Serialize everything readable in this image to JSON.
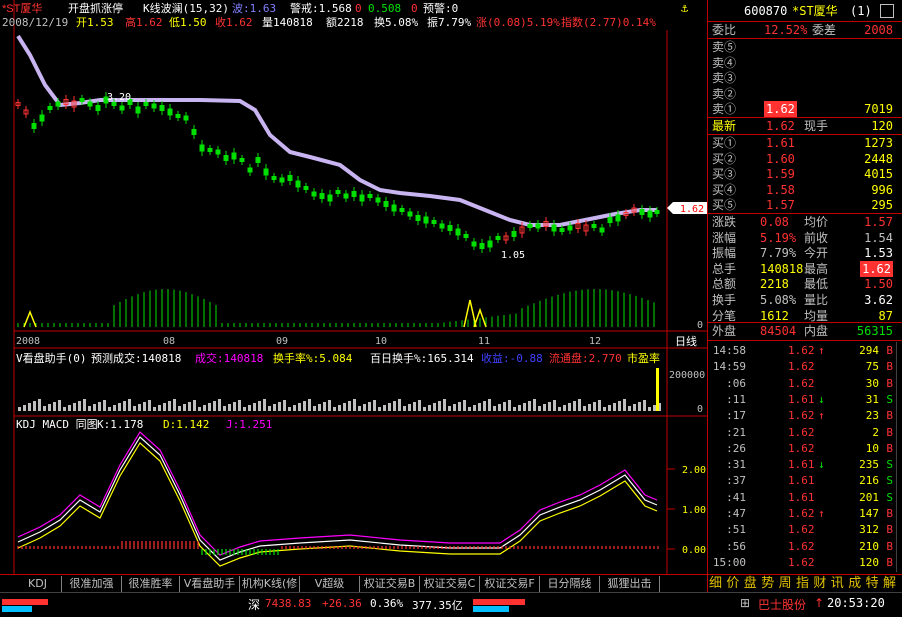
{
  "header": {
    "stock_name": "*ST厦华",
    "strategy": "开盘抓涨停",
    "indicator": "K线波澜(15,32)",
    "wave": "波:1.63",
    "warn_label": "警戒:1.568",
    "val_zero": "0",
    "val_508": "0.508",
    "val_zero2": "0",
    "alert": "预警:0"
  },
  "info_line": {
    "date": "2008/12/19",
    "open": "开1.53",
    "high": "高1.62",
    "low": "低1.50",
    "close": "收1.62",
    "volume": "量140818",
    "amount": "额2218",
    "turnover": "换5.08%",
    "amplitude": "振7.79%",
    "change": "涨(0.08)5.19%",
    "index": "指数(2.77)0.14%"
  },
  "chart_labels": {
    "peak_label": "3.20",
    "low_label": "1.05",
    "price_tag": "1.62",
    "vol_zero": "0",
    "months": [
      "2008",
      "08",
      "09",
      "10",
      "11",
      "12"
    ],
    "period": "日线"
  },
  "vol_panel": {
    "title": "V看盘助手(0)",
    "forecast": "预测成交:140818",
    "deal": "成交:140818",
    "turnover_rate": "换手率%:5.084",
    "hundred_day": "百日换手%:165.314",
    "profit": "收益:-0.88",
    "float": "流通盘:2.770",
    "pe": "市盈率",
    "axis_top": "200000",
    "axis_zero": "0"
  },
  "kdj_panel": {
    "title": "KDJ MACD 同图",
    "k": "K:1.178",
    "d": "D:1.142",
    "j": "J:1.251",
    "y_labels": [
      "2.00",
      "1.00",
      "0.00"
    ]
  },
  "right_panel": {
    "code": "600870",
    "name": "*ST厦华",
    "page": "(1)",
    "wei_bi_label": "委比",
    "wei_bi_value": "12.52%",
    "wei_cha_label": "委差",
    "wei_cha_value": "2008",
    "sell": [
      {
        "label": "卖⑤",
        "price": "",
        "vol": ""
      },
      {
        "label": "卖④",
        "price": "",
        "vol": ""
      },
      {
        "label": "卖③",
        "price": "",
        "vol": ""
      },
      {
        "label": "卖②",
        "price": "",
        "vol": ""
      },
      {
        "label": "卖①",
        "price": "1.62",
        "vol": "7019"
      }
    ],
    "latest_label": "最新",
    "latest_price": "1.62",
    "now_hand_label": "现手",
    "now_hand_value": "120",
    "buy": [
      {
        "label": "买①",
        "price": "1.61",
        "vol": "1273"
      },
      {
        "label": "买②",
        "price": "1.60",
        "vol": "2448"
      },
      {
        "label": "买③",
        "price": "1.59",
        "vol": "4015"
      },
      {
        "label": "买④",
        "price": "1.58",
        "vol": "996"
      },
      {
        "label": "买⑤",
        "price": "1.57",
        "vol": "295"
      }
    ],
    "stats": [
      {
        "l1": "涨跌",
        "v1": "0.08",
        "l2": "均价",
        "v2": "1.57"
      },
      {
        "l1": "涨幅",
        "v1": "5.19%",
        "l2": "前收",
        "v2": "1.54"
      },
      {
        "l1": "振幅",
        "v1": "7.79%",
        "l2": "今开",
        "v2": "1.53"
      },
      {
        "l1": "总手",
        "v1": "140818",
        "l2": "最高",
        "v2": "1.62"
      },
      {
        "l1": "总额",
        "v1": "2218",
        "l2": "最低",
        "v2": "1.50"
      },
      {
        "l1": "换手",
        "v1": "5.08%",
        "l2": "量比",
        "v2": "3.62"
      },
      {
        "l1": "分笔",
        "v1": "1612",
        "l2": "均量",
        "v2": "87"
      }
    ],
    "outer_label": "外盘",
    "outer_value": "84504",
    "inner_label": "内盘",
    "inner_value": "56315",
    "ticks": [
      {
        "t": "14:58",
        "p": "1.62",
        "a": "↑",
        "v": "294",
        "s": "B"
      },
      {
        "t": "14:59",
        "p": "1.62",
        "a": "",
        "v": "75",
        "s": "B"
      },
      {
        "t": ":06",
        "p": "1.62",
        "a": "",
        "v": "30",
        "s": "B"
      },
      {
        "t": ":11",
        "p": "1.61",
        "a": "↓",
        "v": "31",
        "s": "S"
      },
      {
        "t": ":17",
        "p": "1.62",
        "a": "↑",
        "v": "23",
        "s": "B"
      },
      {
        "t": ":21",
        "p": "1.62",
        "a": "",
        "v": "2",
        "s": "B"
      },
      {
        "t": ":26",
        "p": "1.62",
        "a": "",
        "v": "10",
        "s": "B"
      },
      {
        "t": ":31",
        "p": "1.61",
        "a": "↓",
        "v": "235",
        "s": "S"
      },
      {
        "t": ":37",
        "p": "1.61",
        "a": "",
        "v": "216",
        "s": "S"
      },
      {
        "t": ":41",
        "p": "1.61",
        "a": "",
        "v": "201",
        "s": "S"
      },
      {
        "t": ":47",
        "p": "1.62",
        "a": "↑",
        "v": "147",
        "s": "B"
      },
      {
        "t": ":51",
        "p": "1.62",
        "a": "",
        "v": "312",
        "s": "B"
      },
      {
        "t": ":56",
        "p": "1.62",
        "a": "",
        "v": "210",
        "s": "B"
      },
      {
        "t": "15:00",
        "p": "1.62",
        "a": "",
        "v": "120",
        "s": "B"
      }
    ]
  },
  "tabs": [
    "KDJ",
    "很准加强",
    "很准胜率",
    "V看盘助手",
    "机构K线(修",
    "V超级MACD",
    "权证交易B",
    "权证交易C",
    "权证交易F",
    "日分隔线",
    "狐狸出击"
  ],
  "right_tabs": [
    "细",
    "价",
    "盘",
    "势",
    "周",
    "指",
    "财",
    "讯",
    "成",
    "特",
    "解"
  ],
  "status": {
    "market": "深",
    "index_value": "7438.83",
    "index_change": "+26.36",
    "index_pct": "0.36%",
    "index_amount": "377.35亿",
    "broker": "巴士股份",
    "broker_arrow": "↑",
    "time": "20:53:20"
  },
  "colors": {
    "up": "#ff3232",
    "down": "#00e000",
    "ma_line": "#c8b4f0",
    "yellow": "#ffff00",
    "magenta": "#ff00ff",
    "cyan": "#00ffff",
    "grid_red": "#c00000"
  }
}
